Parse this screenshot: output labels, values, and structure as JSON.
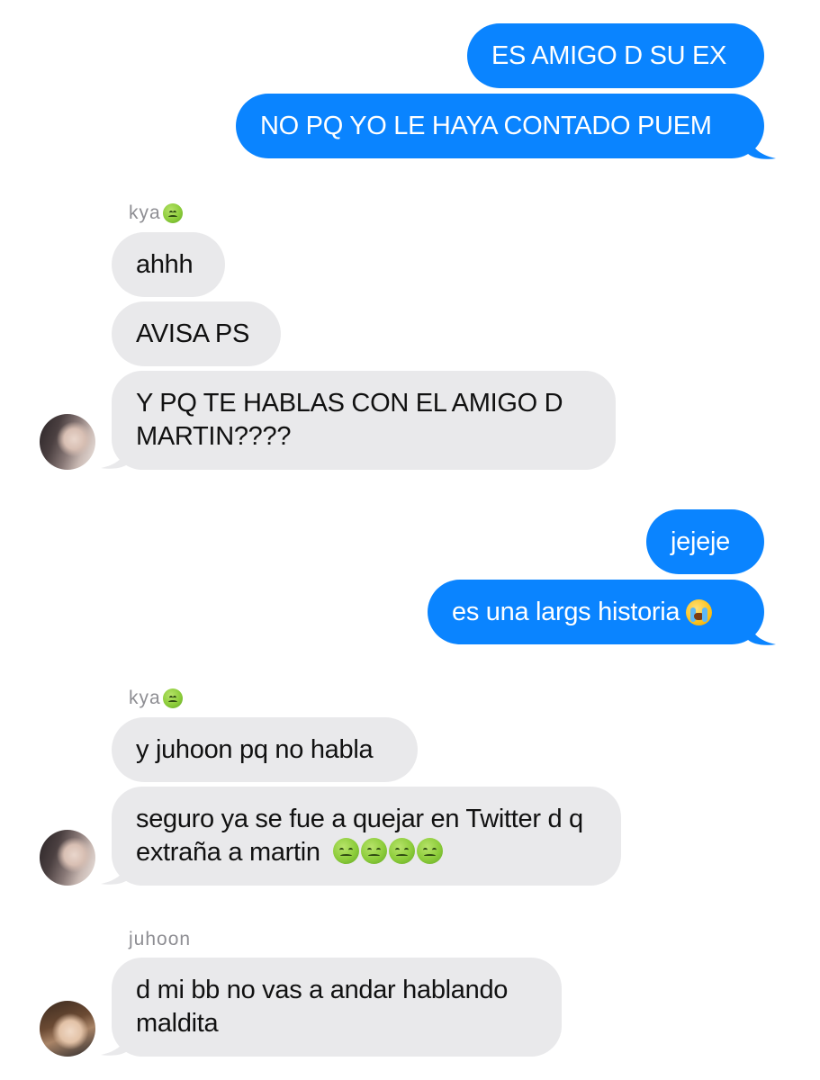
{
  "conversation": {
    "outgoing_1": "ES AMIGO D SU EX",
    "outgoing_2": "NO PQ YO LE HAYA CONTADO PUEM",
    "group_1": {
      "sender": "kya",
      "sender_emoji": "nauseated-face-icon",
      "messages": [
        "ahhh",
        "AVISA PS",
        "Y PQ TE HABLAS CON EL AMIGO D MARTIN????"
      ]
    },
    "outgoing_3": "jejeje",
    "outgoing_4": "es una largs historia",
    "outgoing_4_emoji": "loudly-crying-face-icon",
    "group_2": {
      "sender": "kya",
      "sender_emoji": "nauseated-face-icon",
      "messages": [
        "y juhoon pq no habla",
        "seguro ya se fue a quejar en Twitter d q extraña a martin"
      ],
      "message_2_emojis": [
        "nauseated-face-icon",
        "nauseated-face-icon",
        "nauseated-face-icon",
        "nauseated-face-icon"
      ]
    },
    "group_3": {
      "sender": "juhoon",
      "messages": [
        "d mi bb no vas a andar hablando maldita"
      ]
    }
  },
  "colors": {
    "outgoing_bubble": "#0a84ff",
    "incoming_bubble": "#e9e9eb",
    "sender_name": "#8e8e93"
  }
}
